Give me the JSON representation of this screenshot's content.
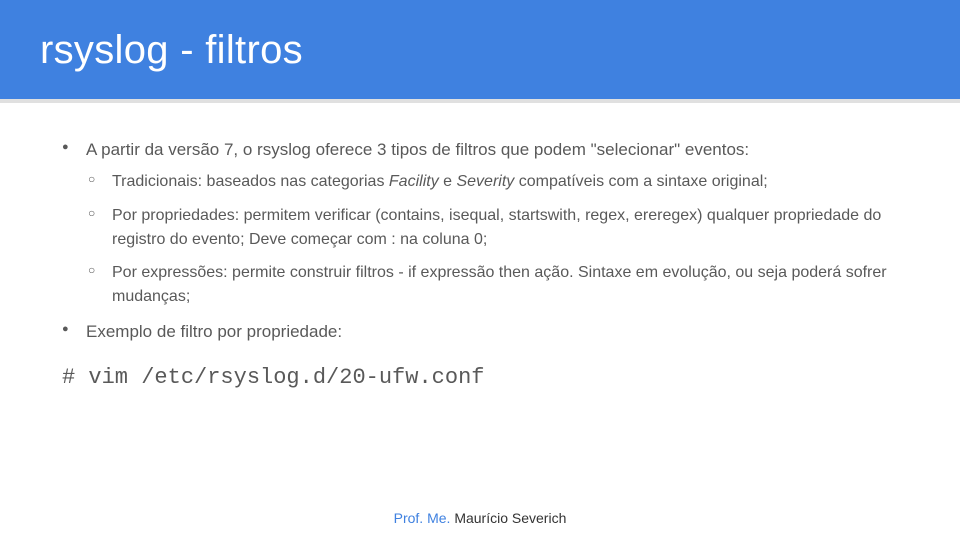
{
  "header": {
    "title": "rsyslog - filtros"
  },
  "bullets": {
    "intro": "A partir da versão 7, o rsyslog oferece 3 tipos de filtros que podem \"selecionar\" eventos:",
    "sub1_pre": "Tradicionais: baseados nas categorias ",
    "sub1_it1": "Facility",
    "sub1_mid": " e ",
    "sub1_it2": "Severity",
    "sub1_post": "  compatíveis com a sintaxe original;",
    "sub2": "Por propriedades: permitem verificar (contains, isequal, startswith, regex, ereregex) qualquer propriedade do registro do evento; Deve começar com : na coluna 0;",
    "sub3": "Por expressões: permite construir filtros - if expressão then ação. Sintaxe em evolução, ou seja poderá sofrer mudanças;",
    "example": "Exemplo de filtro por propriedade:"
  },
  "command": "# vim /etc/rsyslog.d/20-ufw.conf",
  "footer": {
    "prefix": "Prof. Me. ",
    "name": "Maurício Severich"
  }
}
